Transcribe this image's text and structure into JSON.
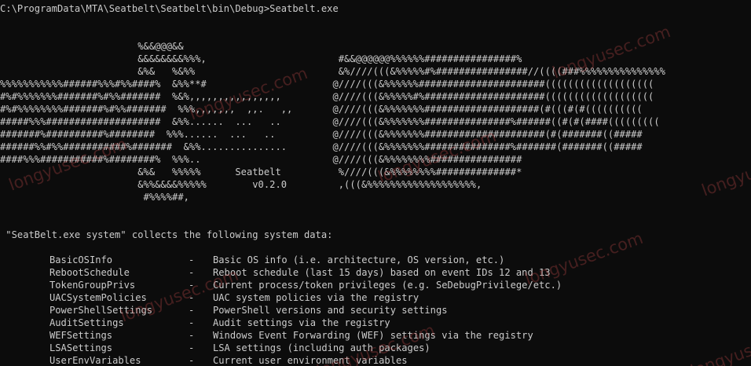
{
  "terminal": {
    "prompt_line": "C:\\ProgramData\\MTA\\Seatbelt\\Seatbelt\\bin\\Debug>Seatbelt.exe"
  },
  "banner": {
    "lines": [
      "                        %&&@@@&&",
      "                        &&&&&&&&%%%,                       #&&@@@@@@%%%%%%################%",
      "                        &%&   %&%%                         &%////(((&%%%%%#%################//((((###%%%%%%%%%%%%%%%",
      "%%%%%%%%%%%######%%%#%%####%  &%%**#                      @////(((&%%%%%%######################(((((((((((((((((((",
      "#%#%%%%%%%#######%#%%#######  %&%,,,,,,,,,,,,,,,,         @////(((&%%%%%#%#####################(((((((((((((((((((",
      "#%#%%%%%%%%#######%#%%#######  %%%,,,,,,,  ,,.   ,,       @////(((&%%%%%%%####################(#(((#(#((((((((((",
      "#####%%%####################  &%%......  ...   ..         @////(((&%%%%%%%###############%######((#(#(####(((((((((",
      "#######%##########%########  %%%......  ...   ..          @////(((&%%%%%%%#####################(#(#######((#####",
      "######%%#%%###########%#######  &%%...............        @////(((&%%%%%%%###############%#######(#######((#####",
      "####%%%###########%########%  %%%..                       @////(((&%%%%%%%%################",
      "                        &%&   %%%%%      Seatbelt          %////(((&%%%%%%%%##############*",
      "                        &%%&&&&%%%%%        v0.2.0         ,(((&%%%%%%%%%%%%%%%%%%%,",
      "                         #%%%%##,"
    ]
  },
  "summary": {
    "intro": " \"SeatBelt.exe system\" collects the following system data:"
  },
  "commands": [
    {
      "name": "BasicOSInfo",
      "dash": "-",
      "desc": "Basic OS info (i.e. architecture, OS version, etc.)"
    },
    {
      "name": "RebootSchedule",
      "dash": "-",
      "desc": "Reboot schedule (last 15 days) based on event IDs 12 and 13"
    },
    {
      "name": "TokenGroupPrivs",
      "dash": "-",
      "desc": "Current process/token privileges (e.g. SeDebugPrivilege/etc.)"
    },
    {
      "name": "UACSystemPolicies",
      "dash": "-",
      "desc": "UAC system policies via the registry"
    },
    {
      "name": "PowerShellSettings",
      "dash": "-",
      "desc": "PowerShell versions and security settings"
    },
    {
      "name": "AuditSettings",
      "dash": "-",
      "desc": "Audit settings via the registry"
    },
    {
      "name": "WEFSettings",
      "dash": "-",
      "desc": "Windows Event Forwarding (WEF) settings via the registry"
    },
    {
      "name": "LSASettings",
      "dash": "-",
      "desc": "LSA settings (including auth packages)"
    },
    {
      "name": "UserEnvVariables",
      "dash": "-",
      "desc": "Current user environment variables"
    }
  ],
  "watermarks": [
    "longyusec.com",
    "longyusec.com",
    "longyusec.com",
    "longyusec.com",
    "longyusec.com",
    "longyusec.com",
    "longyusec.com",
    "longyusec.com",
    "longyu"
  ],
  "colors": {
    "background": "#0c0c0c",
    "foreground": "#cccccc",
    "watermark": "#be4646"
  }
}
